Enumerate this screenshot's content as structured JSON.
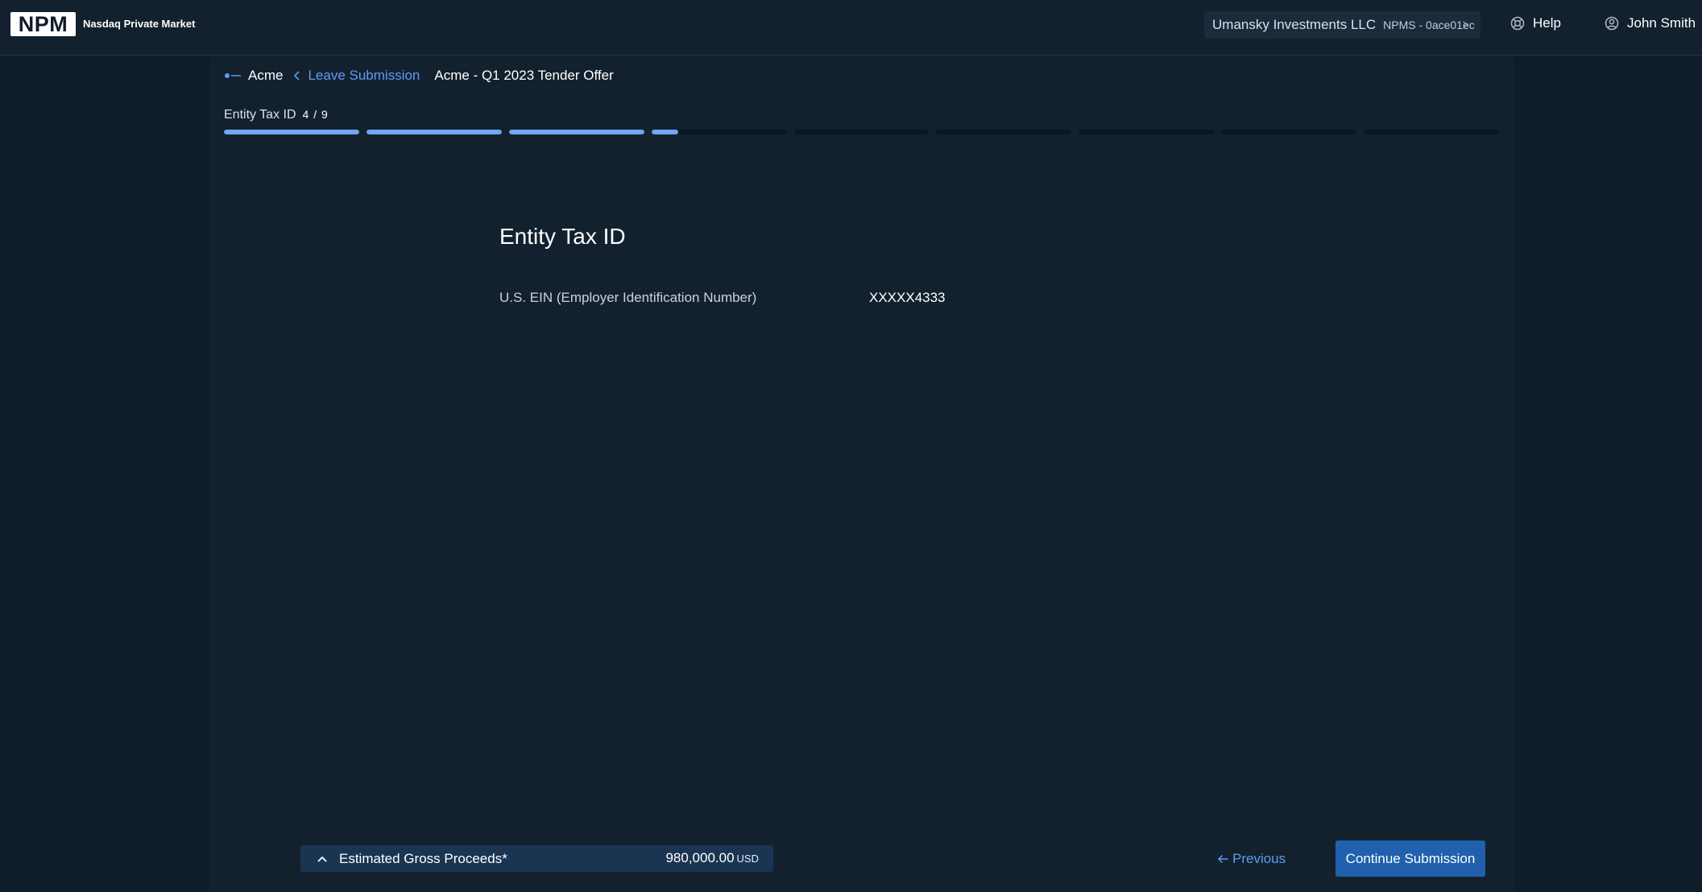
{
  "header": {
    "logo_text": "NPM",
    "brand_name": "Nasdaq Private Market",
    "account": {
      "name": "Umansky Investments LLC",
      "id": "NPMS - 0ace01ec"
    },
    "help_label": "Help",
    "user_name": "John Smith"
  },
  "breadcrumb": {
    "company": "Acme",
    "back_label": "Leave Submission",
    "offer": "Acme - Q1 2023 Tender Offer"
  },
  "progress": {
    "step_label": "Entity Tax ID",
    "step_count": "4 / 9",
    "current_step": 4,
    "total_steps": 9,
    "current_step_fill": 0.2,
    "fill_color": "#6ea7f2",
    "track_color": "#0a1726"
  },
  "main": {
    "title": "Entity Tax ID",
    "field_label": "U.S. EIN (Employer Identification Number)",
    "field_value": "XXXXX4333"
  },
  "footer": {
    "proceeds_label": "Estimated Gross Proceeds*",
    "proceeds_amount": "980,000.00",
    "proceeds_currency": "USD",
    "previous_label": "Previous",
    "continue_label": "Continue Submission"
  },
  "colors": {
    "accent": "#5c9cf0",
    "primary_button": "#2060ad",
    "background": "#0f1c29",
    "panel": "#13212f"
  }
}
